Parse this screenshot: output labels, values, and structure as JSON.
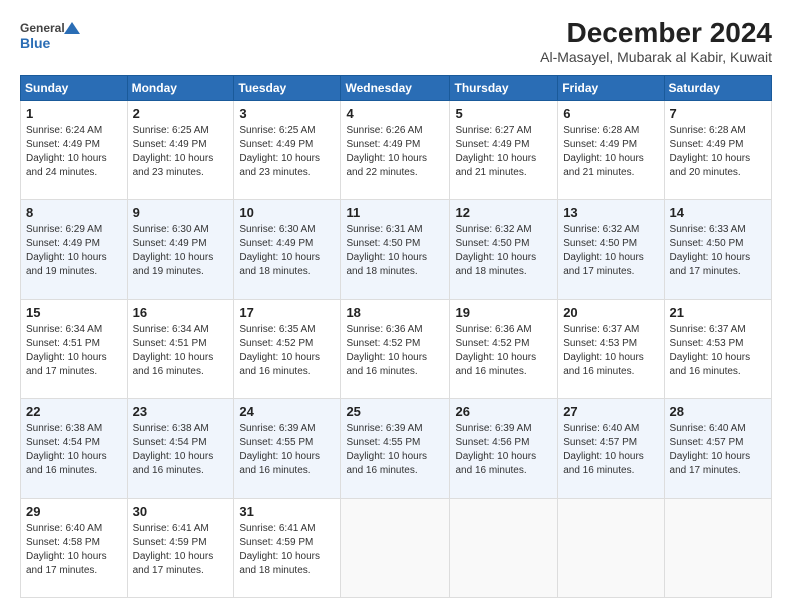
{
  "header": {
    "logo_line1": "General",
    "logo_line2": "Blue",
    "title": "December 2024",
    "subtitle": "Al-Masayel, Mubarak al Kabir, Kuwait"
  },
  "days_of_week": [
    "Sunday",
    "Monday",
    "Tuesday",
    "Wednesday",
    "Thursday",
    "Friday",
    "Saturday"
  ],
  "weeks": [
    [
      {
        "day": 1,
        "sunrise": "6:24 AM",
        "sunset": "4:49 PM",
        "daylight": "10 hours and 24 minutes."
      },
      {
        "day": 2,
        "sunrise": "6:25 AM",
        "sunset": "4:49 PM",
        "daylight": "10 hours and 23 minutes."
      },
      {
        "day": 3,
        "sunrise": "6:25 AM",
        "sunset": "4:49 PM",
        "daylight": "10 hours and 23 minutes."
      },
      {
        "day": 4,
        "sunrise": "6:26 AM",
        "sunset": "4:49 PM",
        "daylight": "10 hours and 22 minutes."
      },
      {
        "day": 5,
        "sunrise": "6:27 AM",
        "sunset": "4:49 PM",
        "daylight": "10 hours and 21 minutes."
      },
      {
        "day": 6,
        "sunrise": "6:28 AM",
        "sunset": "4:49 PM",
        "daylight": "10 hours and 21 minutes."
      },
      {
        "day": 7,
        "sunrise": "6:28 AM",
        "sunset": "4:49 PM",
        "daylight": "10 hours and 20 minutes."
      }
    ],
    [
      {
        "day": 8,
        "sunrise": "6:29 AM",
        "sunset": "4:49 PM",
        "daylight": "10 hours and 19 minutes."
      },
      {
        "day": 9,
        "sunrise": "6:30 AM",
        "sunset": "4:49 PM",
        "daylight": "10 hours and 19 minutes."
      },
      {
        "day": 10,
        "sunrise": "6:30 AM",
        "sunset": "4:49 PM",
        "daylight": "10 hours and 18 minutes."
      },
      {
        "day": 11,
        "sunrise": "6:31 AM",
        "sunset": "4:50 PM",
        "daylight": "10 hours and 18 minutes."
      },
      {
        "day": 12,
        "sunrise": "6:32 AM",
        "sunset": "4:50 PM",
        "daylight": "10 hours and 18 minutes."
      },
      {
        "day": 13,
        "sunrise": "6:32 AM",
        "sunset": "4:50 PM",
        "daylight": "10 hours and 17 minutes."
      },
      {
        "day": 14,
        "sunrise": "6:33 AM",
        "sunset": "4:50 PM",
        "daylight": "10 hours and 17 minutes."
      }
    ],
    [
      {
        "day": 15,
        "sunrise": "6:34 AM",
        "sunset": "4:51 PM",
        "daylight": "10 hours and 17 minutes."
      },
      {
        "day": 16,
        "sunrise": "6:34 AM",
        "sunset": "4:51 PM",
        "daylight": "10 hours and 16 minutes."
      },
      {
        "day": 17,
        "sunrise": "6:35 AM",
        "sunset": "4:52 PM",
        "daylight": "10 hours and 16 minutes."
      },
      {
        "day": 18,
        "sunrise": "6:36 AM",
        "sunset": "4:52 PM",
        "daylight": "10 hours and 16 minutes."
      },
      {
        "day": 19,
        "sunrise": "6:36 AM",
        "sunset": "4:52 PM",
        "daylight": "10 hours and 16 minutes."
      },
      {
        "day": 20,
        "sunrise": "6:37 AM",
        "sunset": "4:53 PM",
        "daylight": "10 hours and 16 minutes."
      },
      {
        "day": 21,
        "sunrise": "6:37 AM",
        "sunset": "4:53 PM",
        "daylight": "10 hours and 16 minutes."
      }
    ],
    [
      {
        "day": 22,
        "sunrise": "6:38 AM",
        "sunset": "4:54 PM",
        "daylight": "10 hours and 16 minutes."
      },
      {
        "day": 23,
        "sunrise": "6:38 AM",
        "sunset": "4:54 PM",
        "daylight": "10 hours and 16 minutes."
      },
      {
        "day": 24,
        "sunrise": "6:39 AM",
        "sunset": "4:55 PM",
        "daylight": "10 hours and 16 minutes."
      },
      {
        "day": 25,
        "sunrise": "6:39 AM",
        "sunset": "4:55 PM",
        "daylight": "10 hours and 16 minutes."
      },
      {
        "day": 26,
        "sunrise": "6:39 AM",
        "sunset": "4:56 PM",
        "daylight": "10 hours and 16 minutes."
      },
      {
        "day": 27,
        "sunrise": "6:40 AM",
        "sunset": "4:57 PM",
        "daylight": "10 hours and 16 minutes."
      },
      {
        "day": 28,
        "sunrise": "6:40 AM",
        "sunset": "4:57 PM",
        "daylight": "10 hours and 17 minutes."
      }
    ],
    [
      {
        "day": 29,
        "sunrise": "6:40 AM",
        "sunset": "4:58 PM",
        "daylight": "10 hours and 17 minutes."
      },
      {
        "day": 30,
        "sunrise": "6:41 AM",
        "sunset": "4:59 PM",
        "daylight": "10 hours and 17 minutes."
      },
      {
        "day": 31,
        "sunrise": "6:41 AM",
        "sunset": "4:59 PM",
        "daylight": "10 hours and 18 minutes."
      },
      null,
      null,
      null,
      null
    ]
  ]
}
